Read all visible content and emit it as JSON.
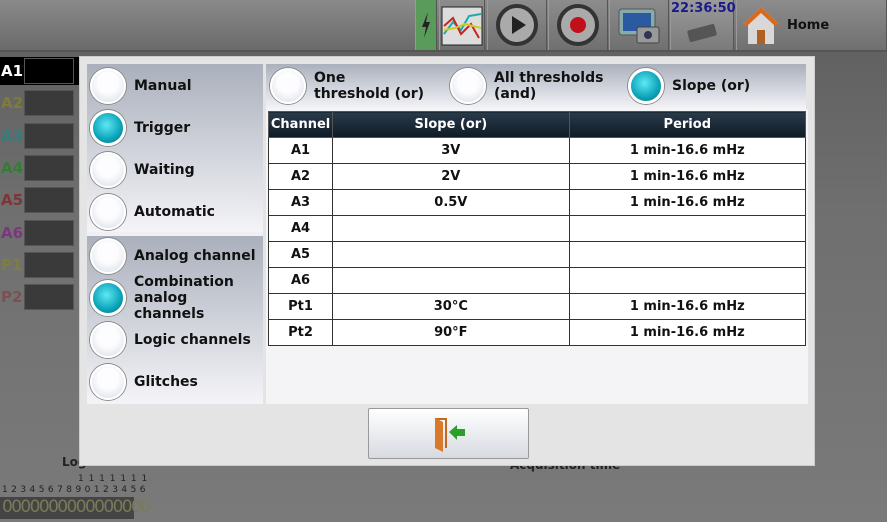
{
  "toolbar": {
    "clock": "22:36:50",
    "home_label": "Home",
    "icons": [
      "battery-icon",
      "chart-icon",
      "play-icon",
      "record-icon",
      "screenshot-icon",
      "memory-chip-icon",
      "home-icon"
    ]
  },
  "channels": [
    {
      "label": "A1",
      "color": "#ffffff"
    },
    {
      "label": "A2",
      "color": "#7d7d35"
    },
    {
      "label": "A3",
      "color": "#357d7d"
    },
    {
      "label": "A4",
      "color": "#357d35"
    },
    {
      "label": "A5",
      "color": "#7d3535"
    },
    {
      "label": "A6",
      "color": "#7d357d"
    },
    {
      "label": "P1",
      "color": "#7d7d45"
    },
    {
      "label": "P2",
      "color": "#7d5050"
    }
  ],
  "modes": [
    {
      "label": "Manual",
      "selected": false
    },
    {
      "label": "Trigger",
      "selected": true
    },
    {
      "label": "Waiting",
      "selected": false
    },
    {
      "label": "Automatic",
      "selected": false
    }
  ],
  "trigger_types": [
    {
      "label": "Analog channel",
      "selected": false
    },
    {
      "label": "Combination analog channels",
      "selected": true
    },
    {
      "label": "Logic channels",
      "selected": false
    },
    {
      "label": "Glitches",
      "selected": false
    }
  ],
  "conditions": [
    {
      "label": "One threshold (or)",
      "selected": false
    },
    {
      "label": "All thresholds (and)",
      "selected": false
    },
    {
      "label": "Slope (or)",
      "selected": true
    }
  ],
  "table": {
    "headers": [
      "Channel",
      "Slope (or)",
      "Period"
    ],
    "rows": [
      [
        "A1",
        "3V",
        "1 min-16.6 mHz"
      ],
      [
        "A2",
        "2V",
        "1 min-16.6 mHz"
      ],
      [
        "A3",
        "0.5V",
        "1 min-16.6 mHz"
      ],
      [
        "A4",
        "",
        ""
      ],
      [
        "A5",
        "",
        ""
      ],
      [
        "A6",
        "",
        ""
      ],
      [
        "Pt1",
        "30°C",
        "1 min-16.6 mHz"
      ],
      [
        "Pt2",
        "90°F",
        "1 min-16.6 mHz"
      ]
    ]
  },
  "exit_icon": "exit-door-icon",
  "background": {
    "logic_label": "Logic channels",
    "acq_label": "Acquisition time",
    "logic_numbers_top": "1 1 1 1 1 1 1",
    "logic_numbers": "1 2 3 4 5 6 7 8 9 0 1 2 3 4 5 6",
    "logic_values": "0000000000000000"
  },
  "accent": "#0aa3b8"
}
